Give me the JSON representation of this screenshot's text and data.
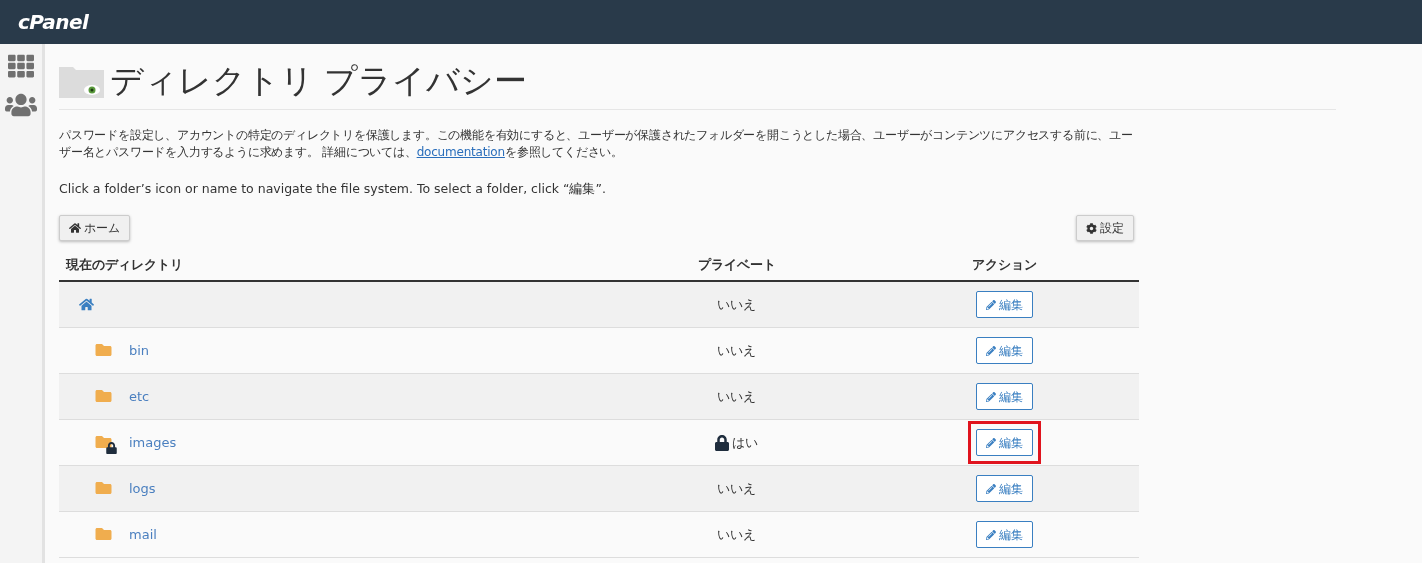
{
  "header": {
    "logo": "cPanel"
  },
  "page": {
    "title": "ディレクトリ プライバシー",
    "description": {
      "before": "パスワードを設定し、アカウントの特定のディレクトリを保護します。この機能を有効にすると、ユーザーが保護されたフォルダーを開こうとした場合、ユーザーがコンテンツにアクセスする前に、ユーザー名とパスワードを入力するように求めます。 詳細については、",
      "link": "documentation",
      "after": "を参照してください。"
    },
    "hint": "Click a folder’s icon or name to navigate the file system. To select a folder, click “編集”.",
    "home_button": "ホーム",
    "settings_button": "設定"
  },
  "table": {
    "columns": [
      "現在のディレクトリ",
      "プライベート",
      "アクション"
    ],
    "rows": [
      {
        "kind": "home",
        "locked": false,
        "private": "いいえ",
        "action": "編集",
        "highlighted": false
      },
      {
        "kind": "folder",
        "name": "bin",
        "locked": false,
        "private": "いいえ",
        "action": "編集",
        "highlighted": false
      },
      {
        "kind": "folder",
        "name": "etc",
        "locked": false,
        "private": "いいえ",
        "action": "編集",
        "highlighted": false
      },
      {
        "kind": "folder",
        "name": "images",
        "locked": true,
        "private": "はい",
        "action": "編集",
        "highlighted": true
      },
      {
        "kind": "folder",
        "name": "logs",
        "locked": false,
        "private": "いいえ",
        "action": "編集",
        "highlighted": false
      },
      {
        "kind": "folder",
        "name": "mail",
        "locked": false,
        "private": "いいえ",
        "action": "編集",
        "highlighted": false
      }
    ]
  }
}
